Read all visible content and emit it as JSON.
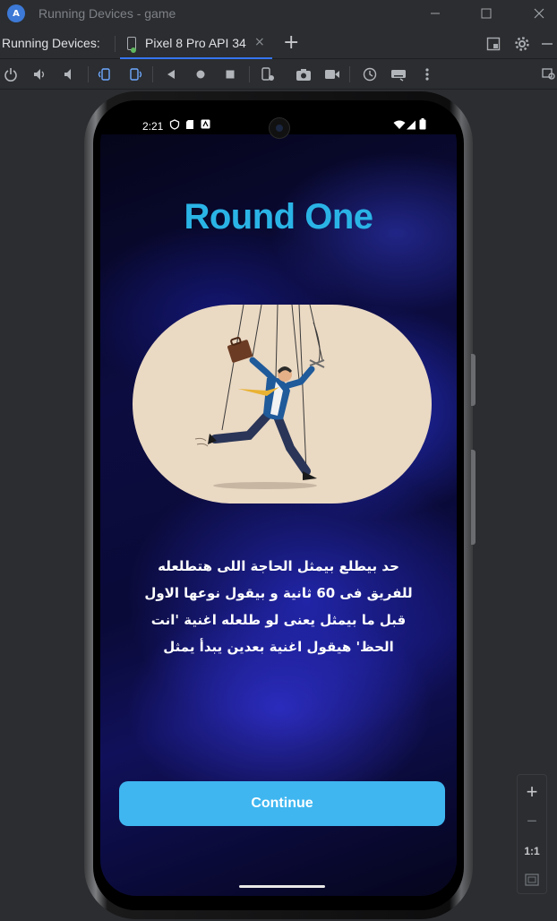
{
  "window": {
    "title": "Running Devices - game",
    "app_logo": "A"
  },
  "tabs": {
    "label": "Running Devices:",
    "device_tab": "Pixel 8 Pro API 34",
    "close": "×",
    "add": "+"
  },
  "status_bar": {
    "time": "2:21"
  },
  "app": {
    "title": "Round One",
    "description": "حد بيطلع بيمثل الحاجة اللى هتطلعله للفريق فى 60 ثانية و بيقول نوعها الاول قبل ما بيمثل يعنى لو طلعله اغنية 'انت الحظ' هيقول اغنية بعدين يبدأ يمثل",
    "continue_label": "Continue"
  },
  "zoom": {
    "zoom_in": "+",
    "zoom_out": "−",
    "actual_size": "1:1"
  },
  "colors": {
    "title": "#2ab4e6",
    "button": "#3fb6f0",
    "illustration_bg": "#ead9c3"
  }
}
